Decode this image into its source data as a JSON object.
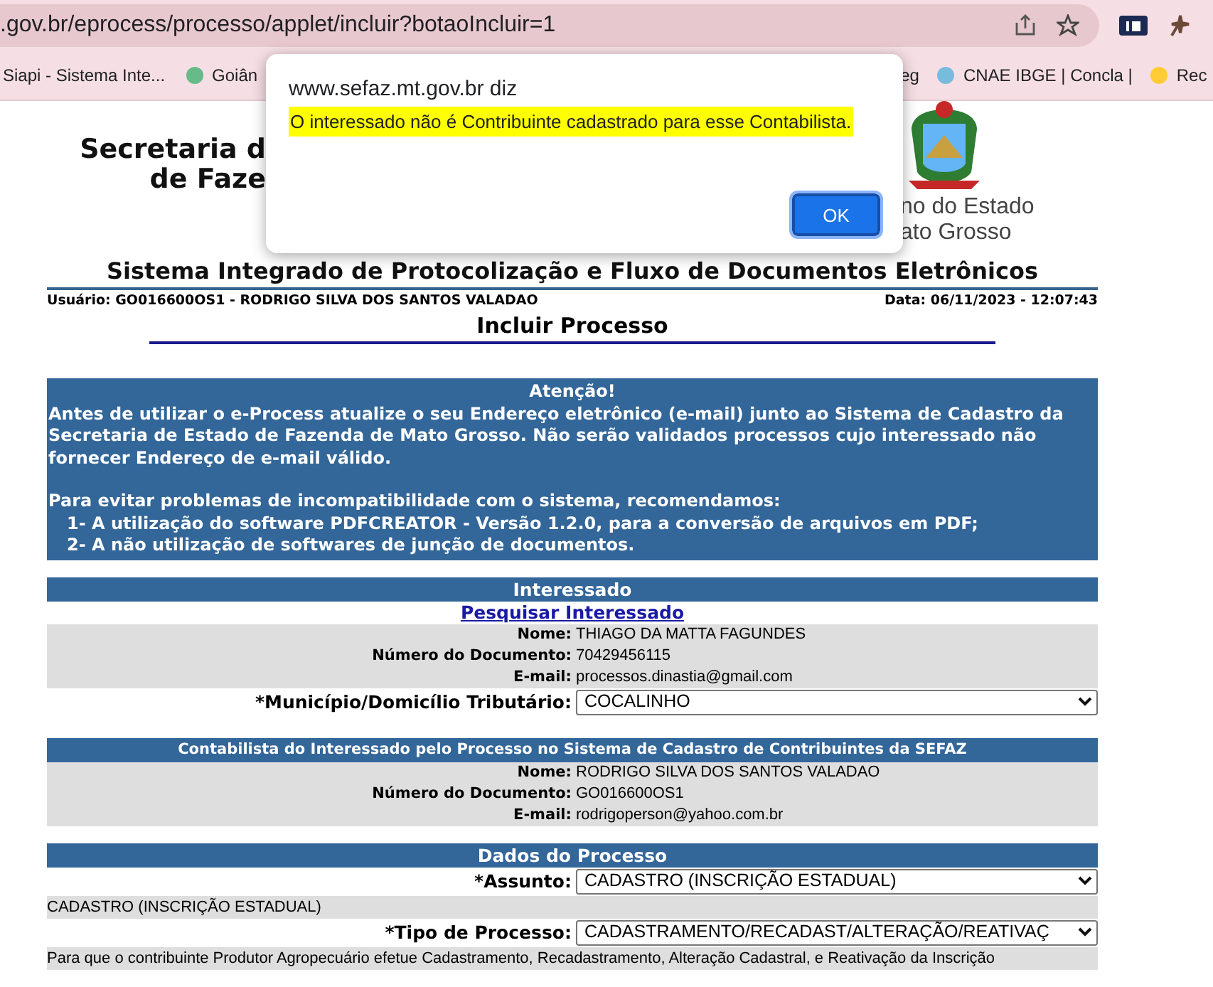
{
  "browser": {
    "address": ".gov.br/eprocess/processo/applet/incluir?botaoIncluir=1",
    "bookmarks": [
      {
        "label": "Siapi - Sistema Inte...",
        "icon": false
      },
      {
        "label": "Goiân",
        "icon": true
      },
      {
        "label": "eg",
        "icon": false
      },
      {
        "label": "CNAE IBGE | Concla |",
        "icon": true
      },
      {
        "label": "Rec",
        "icon": true
      }
    ]
  },
  "dialog": {
    "origin": "www.sefaz.mt.gov.br diz",
    "message": "O interessado não é Contribuinte cadastrado para esse Contabilista.",
    "ok_button": "OK"
  },
  "header": {
    "left_logo_lines": [
      "Secretaria d",
      "de Faze"
    ],
    "right_logo_lines": [
      "no do Estado",
      "ato Grosso"
    ],
    "system_title": "Sistema Integrado de Protocolização e Fluxo de Documentos Eletrônicos",
    "user": "Usuário: GO016600OS1 - RODRIGO SILVA DOS SANTOS VALADAO",
    "date": "Data: 06/11/2023 - 12:07:43",
    "page_title": "Incluir Processo"
  },
  "notice": {
    "title": "Atenção!",
    "paragraphs": [
      "Antes de utilizar o e-Process atualize o seu Endereço eletrônico (e-mail) junto ao Sistema de Cadastro da Secretaria de Estado de Fazenda de Mato Grosso. Não serão validados processos cujo interessado não fornecer Endereço de e-mail válido.",
      "Para evitar problemas de incompatibilidade com o sistema, recomendamos:"
    ],
    "items": [
      "1- A utilização do software PDFCREATOR - Versão 1.2.0, para a conversão de arquivos em PDF;",
      "2- A não utilização de softwares de junção de documentos."
    ]
  },
  "interessado": {
    "title": "Interessado",
    "link": "Pesquisar Interessado",
    "fields": [
      {
        "label": "Nome:",
        "value": "THIAGO DA MATTA FAGUNDES"
      },
      {
        "label": "Número do Documento:",
        "value": "70429456115"
      },
      {
        "label": "E-mail:",
        "value": "processos.dinastia@gmail.com"
      }
    ],
    "municipio": {
      "label": "*Município/Domicílio Tributário:",
      "value": "COCALINHO"
    }
  },
  "contabilista": {
    "title": "Contabilista do Interessado pelo Processo no Sistema de Cadastro de Contribuintes da SEFAZ",
    "fields": [
      {
        "label": "Nome:",
        "value": "RODRIGO SILVA DOS SANTOS VALADAO"
      },
      {
        "label": "Número do Documento:",
        "value": "GO016600OS1"
      },
      {
        "label": "E-mail:",
        "value": "rodrigoperson@yahoo.com.br"
      }
    ]
  },
  "dados": {
    "title": "Dados do Processo",
    "assunto": {
      "label": "*Assunto:",
      "value": "CADASTRO (INSCRIÇÃO ESTADUAL)"
    },
    "assunto_note": "CADASTRO (INSCRIÇÃO ESTADUAL)",
    "tipo": {
      "label": "*Tipo de Processo:",
      "value": "CADASTRAMENTO/RECADAST/ALTERAÇÃO/REATIVAÇ"
    },
    "note": "Para que o contribuinte Produtor Agropecuário efetue Cadastramento, Recadastramento, Alteração Cadastral, e Reativação da Inscrição"
  }
}
